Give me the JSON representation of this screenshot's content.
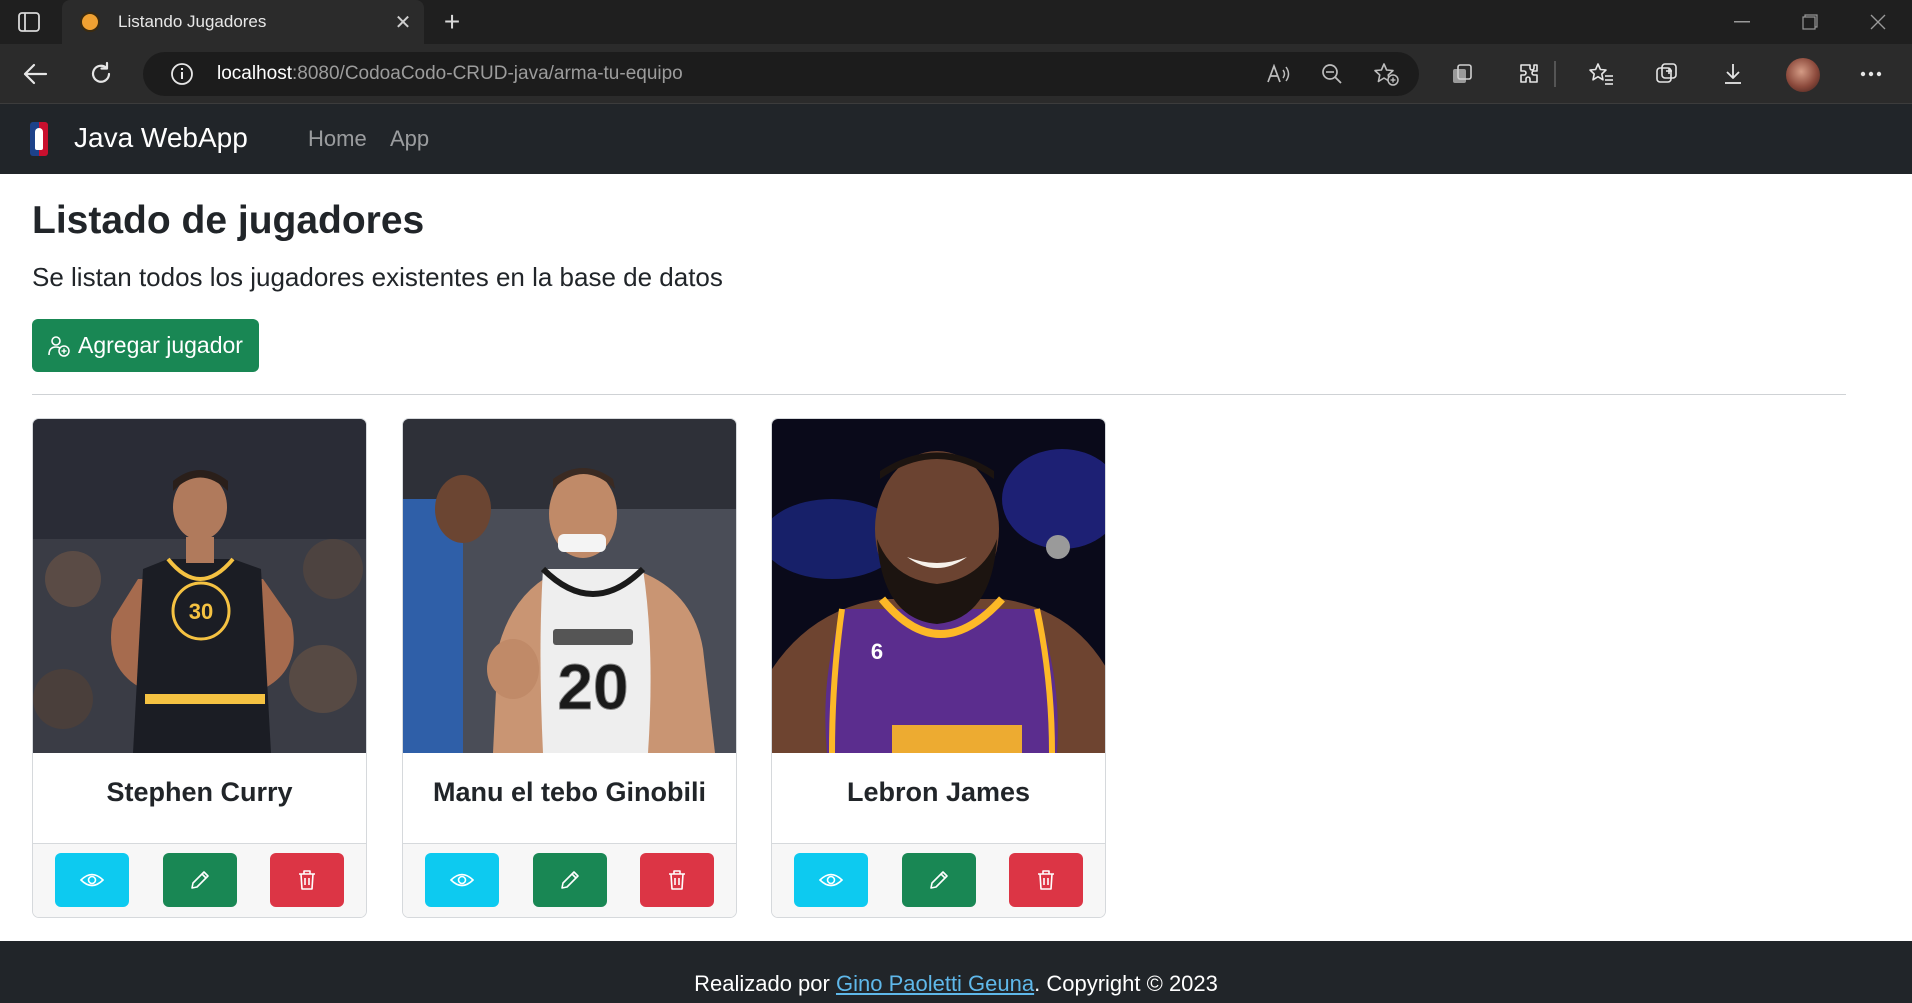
{
  "browser": {
    "tab_title": "Listando Jugadores",
    "tab_close": "✕",
    "new_tab": "+",
    "url_host": "localhost",
    "url_rest": ":8080/CodoaCodo-CRUD-java/arma-tu-equipo"
  },
  "navbar": {
    "brand": "Java WebApp",
    "links": [
      "Home",
      "App"
    ]
  },
  "main": {
    "title": "Listado de jugadores",
    "lead": "Se listan todos los jugadores existentes en la base de datos",
    "add_button": "Agregar jugador"
  },
  "players": [
    {
      "name": "Stephen Curry",
      "jersey": "30",
      "team_color": "#1b1d24",
      "trim_color": "#f5c242",
      "bg": "#3a3c45"
    },
    {
      "name": "Manu el tebo Ginobili",
      "jersey": "20",
      "team_color": "#eeeeee",
      "trim_color": "#1a1a1a",
      "bg": "#4a4d57"
    },
    {
      "name": "Lebron James",
      "jersey": "6",
      "team_color": "#5b2d8e",
      "trim_color": "#fdb927",
      "bg": "#0a0a1a"
    }
  ],
  "actions": {
    "view_icon": "eye-icon",
    "edit_icon": "pencil-icon",
    "delete_icon": "trash-icon"
  },
  "footer": {
    "prefix": "Realizado por ",
    "author": "Gino Paoletti Geuna",
    "suffix": ". Copyright © 2023"
  }
}
